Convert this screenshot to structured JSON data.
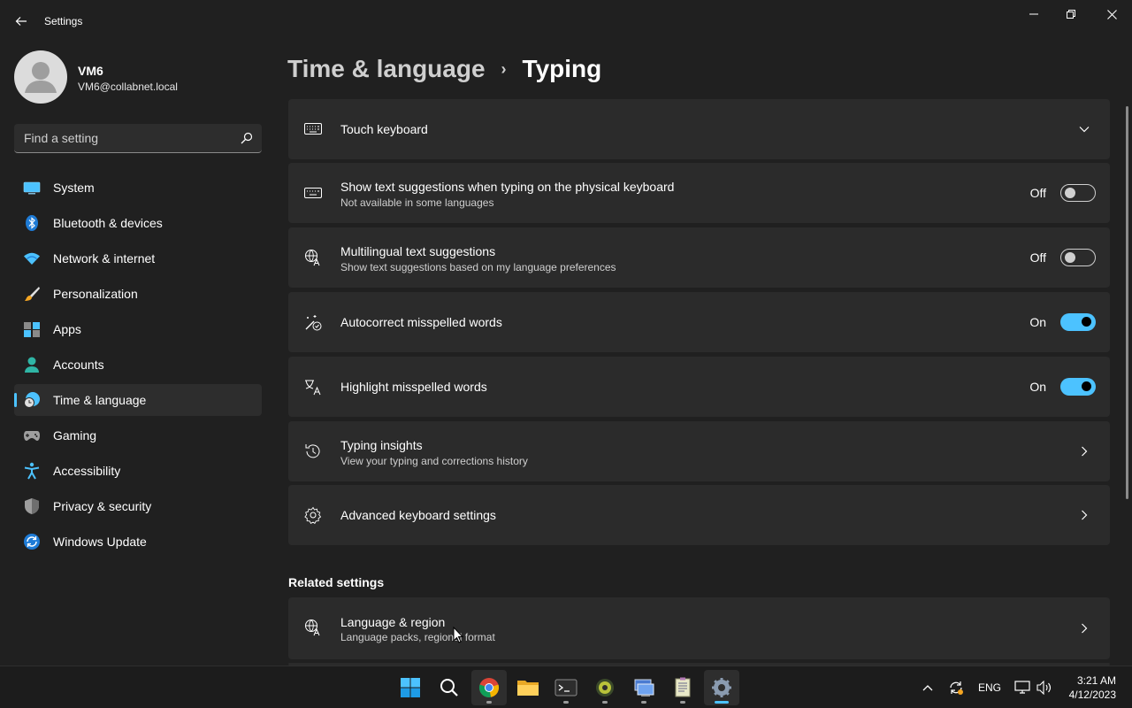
{
  "window": {
    "title": "Settings",
    "back_icon": "back-arrow-icon",
    "controls": [
      "minimize-icon",
      "restore-icon",
      "close-icon"
    ]
  },
  "user": {
    "name": "VM6",
    "email": "VM6@collabnet.local"
  },
  "search": {
    "placeholder": "Find a setting",
    "value": ""
  },
  "sidebar": {
    "items": [
      {
        "label": "System",
        "icon": "system-icon"
      },
      {
        "label": "Bluetooth & devices",
        "icon": "bluetooth-icon"
      },
      {
        "label": "Network & internet",
        "icon": "network-icon"
      },
      {
        "label": "Personalization",
        "icon": "brush-icon"
      },
      {
        "label": "Apps",
        "icon": "apps-icon"
      },
      {
        "label": "Accounts",
        "icon": "accounts-icon"
      },
      {
        "label": "Time & language",
        "icon": "time-language-icon",
        "selected": true
      },
      {
        "label": "Gaming",
        "icon": "gaming-icon"
      },
      {
        "label": "Accessibility",
        "icon": "accessibility-icon"
      },
      {
        "label": "Privacy & security",
        "icon": "shield-icon"
      },
      {
        "label": "Windows Update",
        "icon": "update-icon"
      }
    ]
  },
  "breadcrumb": {
    "parent": "Time & language",
    "separator": "›",
    "current": "Typing"
  },
  "settings": {
    "touch_keyboard": {
      "title": "Touch keyboard"
    },
    "text_suggestions": {
      "title": "Show text suggestions when typing on the physical keyboard",
      "subtitle": "Not available in some languages",
      "state": "Off"
    },
    "multilingual": {
      "title": "Multilingual text suggestions",
      "subtitle": "Show text suggestions based on my language preferences",
      "state": "Off"
    },
    "autocorrect": {
      "title": "Autocorrect misspelled words",
      "state": "On"
    },
    "highlight": {
      "title": "Highlight misspelled words",
      "state": "On"
    },
    "insights": {
      "title": "Typing insights",
      "subtitle": "View your typing and corrections history"
    },
    "advanced": {
      "title": "Advanced keyboard settings"
    }
  },
  "related": {
    "heading": "Related settings",
    "language_region": {
      "title": "Language & region",
      "subtitle": "Language packs, regional format"
    }
  },
  "taskbar": {
    "apps": [
      "start-icon",
      "search-icon",
      "chrome-icon",
      "file-explorer-icon",
      "terminal-icon",
      "app-icon",
      "remote-desktop-icon",
      "notepad-icon",
      "settings-icon"
    ],
    "language": "ENG",
    "time": "3:21 AM",
    "date": "4/12/2023"
  },
  "colors": {
    "accent": "#4cc2ff",
    "background": "#202020",
    "card": "#2b2b2b"
  }
}
